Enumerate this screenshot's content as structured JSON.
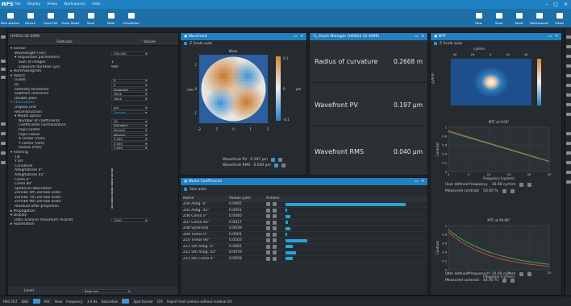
{
  "app": {
    "logo": "WFS",
    "menu": [
      "File",
      "Display",
      "Views",
      "Workspaces",
      "Help"
    ]
  },
  "ribbon": {
    "left": [
      {
        "label": "New session",
        "icon": "new-session-icon"
      },
      {
        "label": "Device",
        "icon": "device-icon"
      },
      {
        "label": "Open file",
        "icon": "open-file-icon"
      },
      {
        "label": "Open folder",
        "icon": "open-folder-icon"
      },
      {
        "label": "Save",
        "icon": "save-icon"
      },
      {
        "label": "Mask",
        "icon": "mask-icon"
      },
      {
        "label": "Simulation",
        "icon": "simulation-icon"
      }
    ],
    "right": [
      {
        "label": "New",
        "icon": "new-icon"
      },
      {
        "label": "Save",
        "icon": "save-icon"
      },
      {
        "label": "Reset",
        "icon": "reset-icon"
      },
      {
        "label": "Workspaces",
        "icon": "workspaces-icon"
      },
      {
        "label": "Views",
        "icon": "views-icon"
      }
    ]
  },
  "left_panel": {
    "title": "HASO3 32-4096",
    "col_features": "Features",
    "col_values": "Values",
    "rows": [
      {
        "k": "▾ Sensor",
        "v": "",
        "indent": 0,
        "kind": "text"
      },
      {
        "k": "Wavelength (nm)",
        "v": "555.000",
        "indent": 2,
        "kind": "select"
      },
      {
        "k": "▾ Acquisition parameters",
        "v": "",
        "indent": 2,
        "kind": "text"
      },
      {
        "k": "Sum of images",
        "v": "1",
        "indent": 4,
        "kind": "text"
      },
      {
        "k": "Exposure duration (µs)",
        "v": "980",
        "indent": 4,
        "kind": "text"
      },
      {
        "k": "▸ Hartmanngram",
        "v": "",
        "indent": 0,
        "kind": "text"
      },
      {
        "k": "▾ Optics",
        "v": "",
        "indent": 0,
        "kind": "text"
      },
      {
        "k": "Grade",
        "v": "6",
        "indent": 2,
        "kind": "select"
      },
      {
        "k": "ID",
        "v": "0",
        "indent": 2,
        "kind": "select"
      },
      {
        "k": "Intensity threshold",
        "v": "Moderate",
        "indent": 2,
        "kind": "select"
      },
      {
        "k": "Subtract reference",
        "v": "None",
        "indent": 2,
        "kind": "select"
      },
      {
        "k": "Double pass",
        "v": "None",
        "indent": 2,
        "kind": "select"
      },
      {
        "k": "▾ Aberrations",
        "v": "",
        "indent": 0,
        "kind": "hl"
      },
      {
        "k": "Display unit",
        "v": "µm",
        "indent": 2,
        "kind": "select"
      },
      {
        "k": "Reconstruction",
        "v": "Zernike",
        "indent": 2,
        "kind": "select-hl"
      },
      {
        "k": "▾ Modal option",
        "v": "",
        "indent": 2,
        "kind": "text"
      },
      {
        "k": "Number of coefficients",
        "v": "32",
        "indent": 4,
        "kind": "select"
      },
      {
        "k": "Coefficients normalization",
        "v": "Standard",
        "indent": 4,
        "kind": "select"
      },
      {
        "k": "Pupil center",
        "v": "Manual",
        "indent": 4,
        "kind": "select"
      },
      {
        "k": "Pupil radius",
        "v": "Manual",
        "indent": 4,
        "kind": "select"
      },
      {
        "k": "X center (mm)",
        "v": "0.000",
        "indent": 4,
        "kind": "select"
      },
      {
        "k": "Y center (mm)",
        "v": "0.000",
        "indent": 4,
        "kind": "select"
      },
      {
        "k": "Radius (mm)",
        "v": "2.000",
        "indent": 4,
        "kind": "select"
      },
      {
        "k": "▾ Filtering",
        "v": "",
        "indent": 0,
        "kind": "text"
      },
      {
        "k": "Tilt",
        "v": "on",
        "indent": 2,
        "kind": "check"
      },
      {
        "k": "Y tilt",
        "v": "on",
        "indent": 2,
        "kind": "check"
      },
      {
        "k": "Curvature",
        "v": "on",
        "indent": 2,
        "kind": "check"
      },
      {
        "k": "Astigmatism 0°",
        "v": "off",
        "indent": 2,
        "kind": "check"
      },
      {
        "k": "Astigmatism 45°",
        "v": "off",
        "indent": 2,
        "kind": "check"
      },
      {
        "k": "Coma 0°",
        "v": "off",
        "indent": 2,
        "kind": "check"
      },
      {
        "k": "Coma 90°",
        "v": "off",
        "indent": 2,
        "kind": "check"
      },
      {
        "k": "Spherical aberration",
        "v": "off",
        "indent": 2,
        "kind": "check"
      },
      {
        "k": "Zernike 5th Zernike order",
        "v": "off",
        "indent": 2,
        "kind": "check"
      },
      {
        "k": "Zernike 7th Zernike order",
        "v": "off",
        "indent": 2,
        "kind": "check"
      },
      {
        "k": "Zernike 9th Zernike order",
        "v": "off",
        "indent": 2,
        "kind": "check"
      },
      {
        "k": "Residual after projection",
        "v": "off",
        "indent": 2,
        "kind": "check"
      },
      {
        "k": "▸ Propagation",
        "v": "",
        "indent": 0,
        "kind": "text"
      },
      {
        "k": "▾ Display",
        "v": "",
        "indent": 0,
        "kind": "text"
      },
      {
        "k": "Data analysis maximum records",
        "v": "1000",
        "indent": 2,
        "kind": "select"
      },
      {
        "k": "▸ Automation",
        "v": "",
        "indent": 0,
        "kind": "text"
      }
    ],
    "level_label": "Level",
    "level_value": "Beginner"
  },
  "wavefront": {
    "title": "Wavefront",
    "zscale": "Z Scale auto",
    "top_label": "Wave",
    "pv_label": "Wavefront PV",
    "pv_value": "0.197 µm",
    "rms_label": "Wavefront RMS",
    "rms_value": "0.040 µm",
    "xticks": [
      "-2",
      "-1",
      "0",
      "1",
      "2"
    ],
    "yticks": [
      "1",
      "0",
      "-1"
    ],
    "cbar": [
      "0.1",
      "0",
      "-0.1"
    ],
    "cbar_unit": "µm",
    "yunit": "mm"
  },
  "zoom_manager": {
    "title": "Zoom Manager (HASO3 32-4096)",
    "items": [
      {
        "label": "Radius of curvature",
        "value": "0.2668 m"
      },
      {
        "label": "Wavefront PV",
        "value": "0.197 µm"
      },
      {
        "label": "Wavefront RMS",
        "value": "0.040 µm"
      }
    ]
  },
  "mtf": {
    "title": "MTF",
    "zscale": "Z Scale auto",
    "top_unit": "cy/mm",
    "top_ticks": [
      "40",
      "20",
      "0",
      "20",
      "40"
    ],
    "yaxis_unit": "cy/mm",
    "chart1_title": "MTF at 0.00°",
    "chart2_title": "MTF at 90.00°",
    "xlabel": "Frequency (cy/mm)",
    "ylabel": "Contrast",
    "xticks": [
      "0",
      "5",
      "10",
      "15",
      "20",
      "25"
    ],
    "yticks": [
      "1",
      "0.8",
      "0.6",
      "0.4",
      "0.2",
      "0"
    ],
    "c1_freq_label": "User defined frequency",
    "c1_freq_value": "10.00 cy/mm",
    "c1_contrast_label": "Measured contrast",
    "c1_contrast_value": "50.00 %",
    "c2_freq_label": "User defined frequency",
    "c2_freq_value": "10.00 cy/mm",
    "c2_contrast_label": "Measured contrast",
    "c2_contrast_value": "44.90 %"
  },
  "modal": {
    "title": "Modal Coefficients",
    "sizeauto": "Size auto",
    "h_name": "Name",
    "h_values": "Values (µm)",
    "h_actions": "Actions",
    "rows": [
      {
        "n": "Z04 Astig. 0°",
        "v": "0.0905",
        "b": 0.92
      },
      {
        "n": "Z05 Astig. 45°",
        "v": "0.0001",
        "b": 0.01
      },
      {
        "n": "Z06 Coma 0°",
        "v": "0.0040",
        "b": 0.04
      },
      {
        "n": "Z07 Coma 90°",
        "v": "0.0017",
        "b": 0.02
      },
      {
        "n": "Z08 Spherical",
        "v": "0.0039",
        "b": 0.04
      },
      {
        "n": "Z09 Trefoil 0°",
        "v": "0.0001",
        "b": 0.01
      },
      {
        "n": "Z10 Trefoil 90°",
        "v": "0.0163",
        "b": 0.17
      },
      {
        "n": "Z11 5th Astig. 0°",
        "v": "0.0062",
        "b": 0.06
      },
      {
        "n": "Z12 5th Astig. 45°",
        "v": "0.0076",
        "b": 0.08
      },
      {
        "n": "Z13 5th Coma 0°",
        "v": "0.0058",
        "b": 0.06
      }
    ]
  },
  "status": {
    "items": [
      "HSG FILT",
      "IDLE",
      "REC",
      "View",
      "Frequency",
      "3.0 Hz",
      "Saturation",
      "Spot tracker",
      "LTR",
      "Import from camera without residual tilt"
    ]
  },
  "colors": {
    "accent": "#1f80c2",
    "ribbon": "#1e6fa8",
    "bar": "#2aa3d6",
    "mtf_red": "#d0504a",
    "mtf_green": "#4caf50"
  }
}
